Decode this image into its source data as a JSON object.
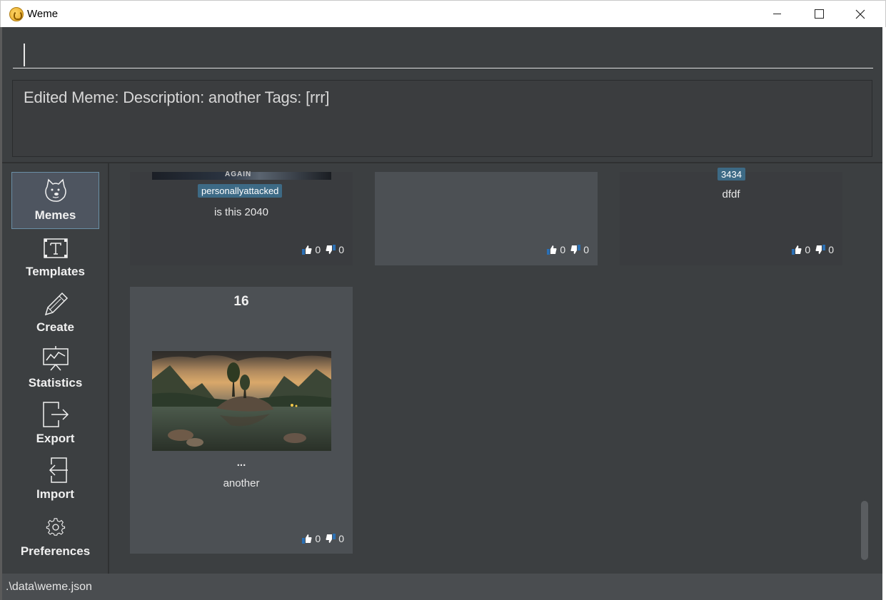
{
  "window": {
    "title": "Weme"
  },
  "command": {
    "value": "",
    "placeholder": ""
  },
  "result": {
    "text": "Edited Meme:  Description: another Tags: [rrr]"
  },
  "sidebar": {
    "items": [
      {
        "label": "Memes",
        "icon": "doge-icon",
        "active": true
      },
      {
        "label": "Templates",
        "icon": "template-icon",
        "active": false
      },
      {
        "label": "Create",
        "icon": "pencil-icon",
        "active": false
      },
      {
        "label": "Statistics",
        "icon": "statistics-icon",
        "active": false
      },
      {
        "label": "Export",
        "icon": "export-icon",
        "active": false
      },
      {
        "label": "Import",
        "icon": "import-icon",
        "active": false
      },
      {
        "label": "Preferences",
        "icon": "gear-icon",
        "active": false
      }
    ]
  },
  "memes": [
    {
      "tag": "personallyattacked",
      "description": "is this 2040",
      "likes": "0",
      "dislikes": "0",
      "image_text": "AGAIN"
    },
    {
      "likes": "0",
      "dislikes": "0"
    },
    {
      "tag": "3434",
      "description": "dfdf",
      "likes": "0",
      "dislikes": "0"
    },
    {
      "number": "16",
      "ellipsis": "...",
      "description": "another",
      "likes": "0",
      "dislikes": "0"
    }
  ],
  "status": {
    "path": ".\\data\\weme.json"
  },
  "colors": {
    "background": "#3c3f41",
    "tag": "#3d6a85",
    "accent": "#6a8fa6"
  }
}
